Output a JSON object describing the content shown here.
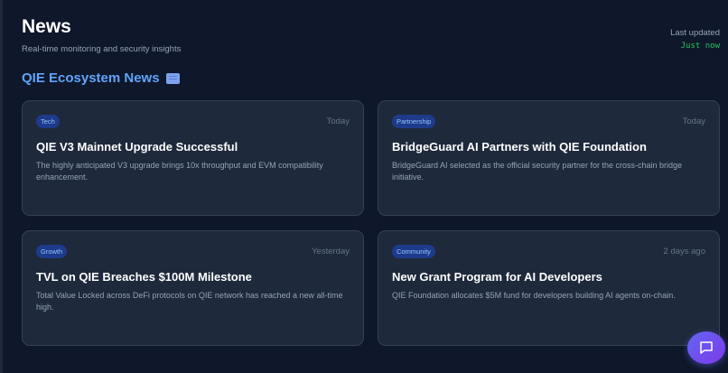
{
  "header": {
    "title": "News",
    "subtitle": "Real-time monitoring and security insights"
  },
  "last_updated": {
    "label": "Last updated",
    "value": "Just now"
  },
  "section": {
    "title": "QIE Ecosystem News",
    "icon": "newspaper-icon"
  },
  "news": [
    {
      "badge": "Tech",
      "date": "Today",
      "title": "QIE V3 Mainnet Upgrade Successful",
      "description": "The highly anticipated V3 upgrade brings 10x throughput and EVM compatibility enhancement."
    },
    {
      "badge": "Partnership",
      "date": "Today",
      "title": "BridgeGuard AI Partners with QIE Foundation",
      "description": "BridgeGuard AI selected as the official security partner for the cross-chain bridge initiative."
    },
    {
      "badge": "Growth",
      "date": "Yesterday",
      "title": "TVL on QIE Breaches $100M Milestone",
      "description": "Total Value Locked across DeFi protocols on QIE network has reached a new all-time high."
    },
    {
      "badge": "Community",
      "date": "2 days ago",
      "title": "New Grant Program for AI Developers",
      "description": "QIE Foundation allocates $5M fund for developers building AI agents on-chain."
    }
  ],
  "chat": {
    "icon": "chat-bubble-icon"
  },
  "colors": {
    "background": "#0f172a",
    "card": "#1e293b",
    "accent": "#60a5fa",
    "live": "#22c55e",
    "chat_gradient_start": "#6366f1",
    "chat_gradient_end": "#7c3aed"
  }
}
